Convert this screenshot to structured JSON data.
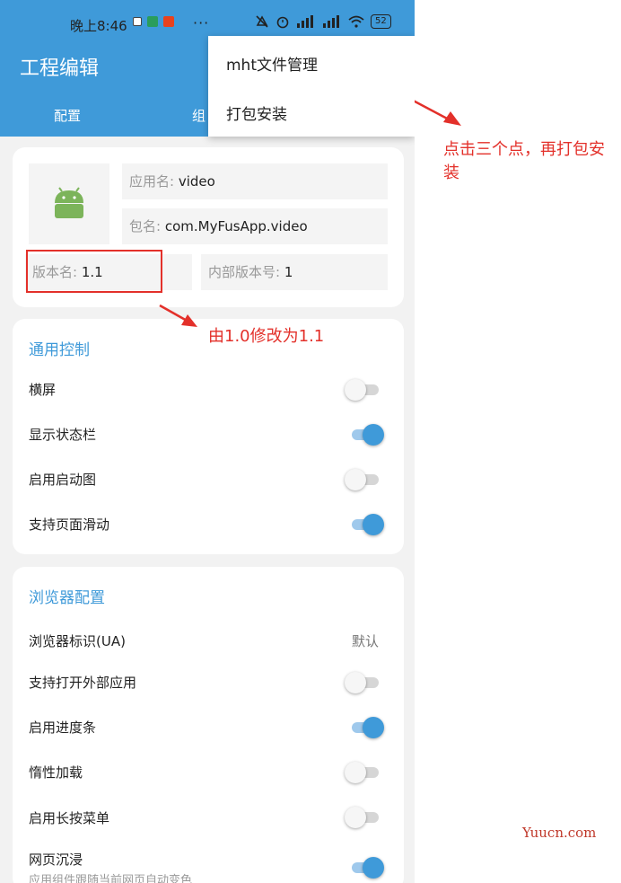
{
  "status_bar": {
    "time": "晚上8:46",
    "battery": "52"
  },
  "app_bar": {
    "title": "工程编辑",
    "tabs": [
      "配置",
      "组"
    ]
  },
  "overflow_menu": {
    "items": [
      "mht文件管理",
      "打包安装"
    ]
  },
  "app_info": {
    "app_name_label": "应用名:",
    "app_name_value": "video",
    "package_label": "包名:",
    "package_value": "com.MyFusApp.video",
    "version_name_label": "版本名:",
    "version_name_value": "1.1",
    "version_code_label": "内部版本号:",
    "version_code_value": "1"
  },
  "general_control": {
    "title": "通用控制",
    "items": [
      {
        "label": "横屏",
        "on": false
      },
      {
        "label": "显示状态栏",
        "on": true
      },
      {
        "label": "启用启动图",
        "on": false
      },
      {
        "label": "支持页面滑动",
        "on": true
      }
    ]
  },
  "browser_config": {
    "title": "浏览器配置",
    "ua_label": "浏览器标识(UA)",
    "ua_value": "默认",
    "items": [
      {
        "label": "支持打开外部应用",
        "on": false
      },
      {
        "label": "启用进度条",
        "on": true
      },
      {
        "label": "惰性加载",
        "on": false
      },
      {
        "label": "启用长按菜单",
        "on": false
      },
      {
        "label": "网页沉浸",
        "sub": "应用组件跟随当前网页自动变色",
        "on": true
      }
    ]
  },
  "annotations": {
    "menu_note": "点击三个点，再打包安装",
    "version_note": "由1.0修改为1.1"
  },
  "watermark": "Yuucn.com",
  "colors": {
    "accent": "#3f9ad9",
    "annotation": "#e3302a"
  }
}
